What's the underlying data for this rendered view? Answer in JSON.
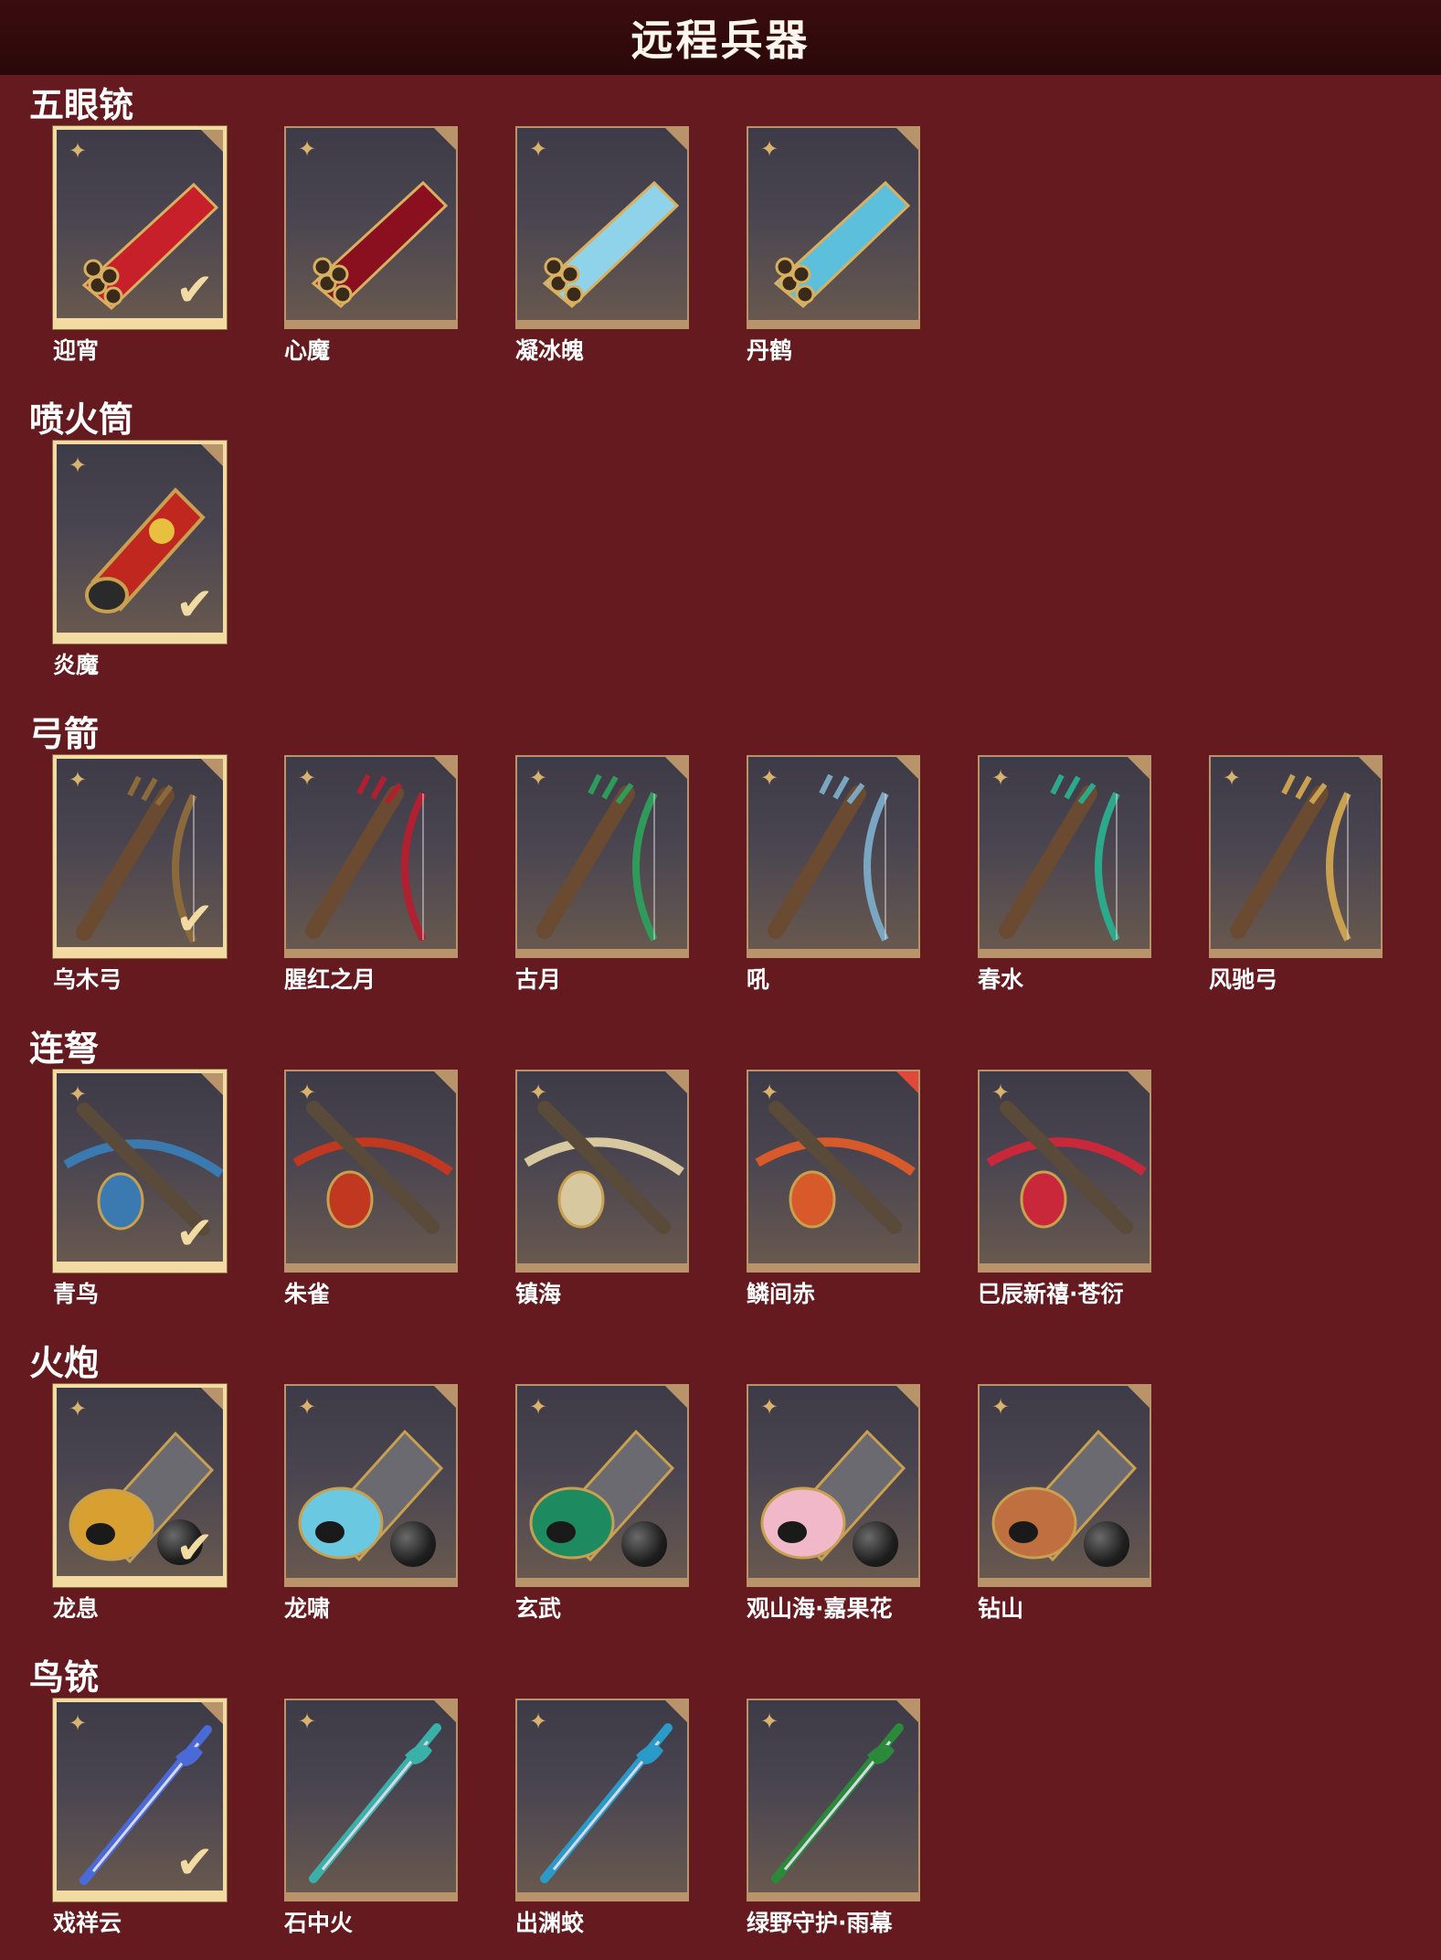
{
  "title": "远程兵器",
  "colors": {
    "background": "#641a1e",
    "titlebar": "#2a0809",
    "card_border": "#b9946a",
    "selected_border": "#f2dba3"
  },
  "sections": [
    {
      "name": "五眼铳",
      "items": [
        {
          "label": "迎宵",
          "selected": true,
          "icon": "five-barrel-gun-icon",
          "accent": "#c8202a"
        },
        {
          "label": "心魔",
          "selected": false,
          "icon": "five-barrel-gun-icon",
          "accent": "#8a1020"
        },
        {
          "label": "凝冰魄",
          "selected": false,
          "icon": "five-barrel-gun-icon",
          "accent": "#8fd3ea"
        },
        {
          "label": "丹鹤",
          "selected": false,
          "icon": "five-barrel-gun-icon",
          "accent": "#5cc0dc"
        }
      ]
    },
    {
      "name": "喷火筒",
      "items": [
        {
          "label": "炎魔",
          "selected": true,
          "icon": "flamethrower-icon",
          "accent": "#c0281f"
        }
      ]
    },
    {
      "name": "弓箭",
      "items": [
        {
          "label": "乌木弓",
          "selected": true,
          "icon": "bow-icon",
          "accent": "#8a6a3c"
        },
        {
          "label": "腥红之月",
          "selected": false,
          "icon": "bow-icon",
          "accent": "#b02030"
        },
        {
          "label": "古月",
          "selected": false,
          "icon": "bow-icon",
          "accent": "#2f9a5a"
        },
        {
          "label": "吼",
          "selected": false,
          "icon": "bow-icon",
          "accent": "#7aa6c2"
        },
        {
          "label": "春水",
          "selected": false,
          "icon": "bow-icon",
          "accent": "#2ca88a"
        },
        {
          "label": "风驰弓",
          "selected": false,
          "icon": "bow-icon",
          "accent": "#c8a050"
        }
      ]
    },
    {
      "name": "连弩",
      "items": [
        {
          "label": "青鸟",
          "selected": true,
          "icon": "crossbow-icon",
          "accent": "#3a7ab0"
        },
        {
          "label": "朱雀",
          "selected": false,
          "icon": "crossbow-icon",
          "accent": "#c0381f"
        },
        {
          "label": "镇海",
          "selected": false,
          "icon": "crossbow-icon",
          "accent": "#d8c8a0"
        },
        {
          "label": "鳞间赤",
          "selected": false,
          "icon": "crossbow-icon",
          "accent": "#d85a2a",
          "new": true
        },
        {
          "label": "巳辰新禧·苍衍",
          "selected": false,
          "icon": "crossbow-icon",
          "accent": "#c8283a"
        }
      ]
    },
    {
      "name": "火炮",
      "items": [
        {
          "label": "龙息",
          "selected": true,
          "icon": "cannon-icon",
          "accent": "#d8a030",
          "ball": true
        },
        {
          "label": "龙啸",
          "selected": false,
          "icon": "cannon-icon",
          "accent": "#6ac8e0",
          "ball": true
        },
        {
          "label": "玄武",
          "selected": false,
          "icon": "cannon-icon",
          "accent": "#1e8a60",
          "ball": true
        },
        {
          "label": "观山海·嘉果花",
          "selected": false,
          "icon": "cannon-icon",
          "accent": "#f0b8c8",
          "ball": true
        },
        {
          "label": "钻山",
          "selected": false,
          "icon": "cannon-icon",
          "accent": "#c07040",
          "ball": true
        }
      ]
    },
    {
      "name": "鸟铳",
      "items": [
        {
          "label": "戏祥云",
          "selected": true,
          "icon": "musket-icon",
          "accent": "#4a6ad8"
        },
        {
          "label": "石中火",
          "selected": false,
          "icon": "musket-icon",
          "accent": "#3ab0a8"
        },
        {
          "label": "出渊蛟",
          "selected": false,
          "icon": "musket-icon",
          "accent": "#2a9ac8"
        },
        {
          "label": "绿野守护·雨幕",
          "selected": false,
          "icon": "musket-icon",
          "accent": "#2a8a3a"
        }
      ]
    }
  ]
}
